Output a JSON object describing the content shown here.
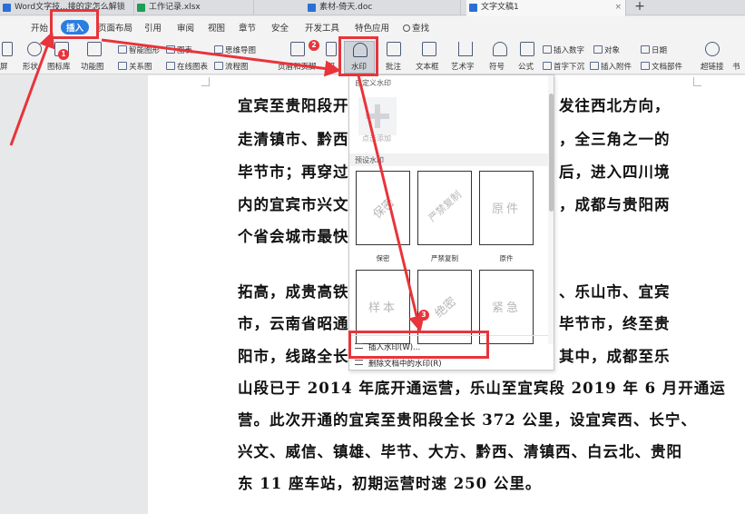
{
  "tabs": [
    {
      "label": "Word文字技...接的定怎么解锁",
      "color": "#2b6fd6",
      "active": false
    },
    {
      "label": "工作记录.xlsx",
      "color": "#1f9d55",
      "active": false
    },
    {
      "label": "素材-倚天.doc",
      "color": "#2b6fd6",
      "active": false
    },
    {
      "label": "文字文稿1",
      "color": "#2b6fd6",
      "active": true
    }
  ],
  "menu": {
    "items": [
      "开始",
      "插入",
      "页面布局",
      "引用",
      "审阅",
      "视图",
      "章节",
      "安全",
      "开发工具",
      "特色应用"
    ],
    "search": "查找"
  },
  "ribbon": {
    "left_cut": "屏",
    "shape": "形状",
    "icon_lib": "图标库",
    "func_map": "功能图",
    "smart_shape": "智能图形",
    "chart": "图表",
    "mind_map": "思维导图",
    "relation_map": "关系图",
    "online_chart": "在线图表",
    "flow_chart": "流程图",
    "header_footer": "页眉和页脚",
    "page_num_cut": "码",
    "watermark": "水印",
    "comment": "批注",
    "textbox": "文本框",
    "art_text": "艺术字",
    "symbol": "符号",
    "formula": "公式",
    "insert_number": "插入数字",
    "object": "对象",
    "date": "日期",
    "first_drop": "首字下沉",
    "insert_attach": "插入附件",
    "doc_parts": "文档部件",
    "hyperlink": "超链接",
    "bookmark_cut": "书"
  },
  "document": {
    "lines": [
      "宜宾至贵阳段开...",
      "走清镇市、黔西...",
      "毕节市；再穿过...",
      "内的宜宾市兴文...",
      "个省会城市最快...",
      "拓高，成贵高铁...",
      "市，云南省昭通...",
      "阳市，线路全长...",
      "山段已于 2014 年底开通运营，乐山至宜宾段 2019 年 6 月开通运",
      "营。此次开通的宜宾至贵阳段全长 372 公里，设宜宾西、长宁、",
      "兴文、威信、镇雄、毕节、大方、黔西、清镇西、白云北、贵阳",
      "东 11 座车站，初期运营时速 250 公里。"
    ],
    "right_fragments": [
      "发往西北方向，",
      "，全三角之一的",
      "后，进入四川境",
      "，成都与贵阳两",
      "、乐山市、宜宾",
      "毕节市，终至贵",
      "其中，成都至乐"
    ]
  },
  "watermark_menu": {
    "custom_header": "自定义水印",
    "add_label": "点击添加",
    "preset_header": "预设水印",
    "presets": [
      {
        "text": "保密",
        "label": "保密"
      },
      {
        "text": "严禁复制",
        "label": "严禁复制"
      },
      {
        "text": "原件",
        "label": "原件"
      },
      {
        "text": "样本",
        "label": ""
      },
      {
        "text": "绝密",
        "label": ""
      },
      {
        "text": "紧急",
        "label": ""
      }
    ],
    "insert": "插入水印(W)...",
    "remove": "删除文档中的水印(R)"
  },
  "annotations": {
    "b1": "1",
    "b2": "2",
    "b3": "3",
    "color": "#e8343a"
  }
}
